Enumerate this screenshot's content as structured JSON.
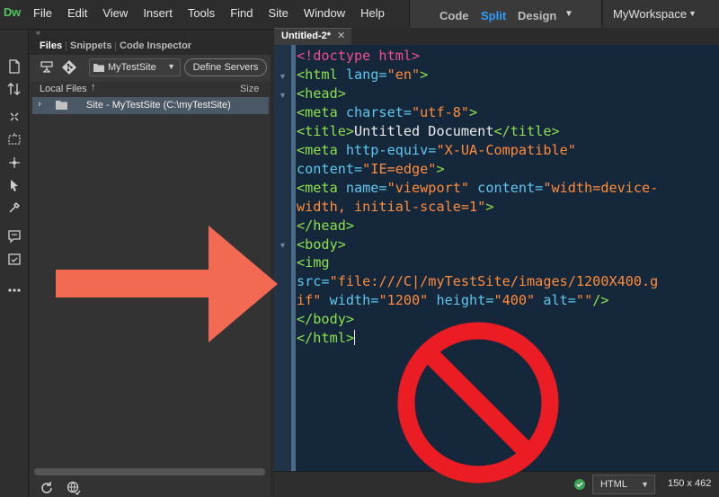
{
  "app": {
    "logo": "Dw",
    "menu": [
      "File",
      "Edit",
      "View",
      "Insert",
      "Tools",
      "Find",
      "Site",
      "Window",
      "Help"
    ],
    "view_switcher": {
      "code": "Code",
      "split": "Split",
      "design": "Design",
      "active": "Split"
    },
    "workspace": "MyWorkspace"
  },
  "files_panel": {
    "tabs": [
      "Files",
      "Snippets",
      "Code Inspector"
    ],
    "active_tab": "Files",
    "site_select": "MyTestSite",
    "define_servers": "Define Servers",
    "column_local": "Local Files",
    "column_size": "Size",
    "site_row_label": "Site - MyTestSite (C:\\myTestSite)"
  },
  "document": {
    "tab_label": "Untitled-2*",
    "code_lines": [
      [
        [
          "d",
          "<!doctype html>"
        ]
      ],
      [
        [
          "t",
          "<html"
        ],
        [
          "a",
          " lang="
        ],
        [
          "v",
          "\"en\""
        ],
        [
          "t",
          ">"
        ]
      ],
      [
        [
          "t",
          "<head>"
        ]
      ],
      [
        [
          "t",
          "<meta"
        ],
        [
          "a",
          " charset="
        ],
        [
          "v",
          "\"utf-8\""
        ],
        [
          "t",
          ">"
        ]
      ],
      [
        [
          "t",
          "<title>"
        ],
        [
          "x",
          "Untitled Document"
        ],
        [
          "t",
          "</title>"
        ]
      ],
      [
        [
          "t",
          "<meta"
        ],
        [
          "a",
          " http-equiv="
        ],
        [
          "v",
          "\"X-UA-Compatible\""
        ]
      ],
      [
        [
          "a",
          "content="
        ],
        [
          "v",
          "\"IE=edge\""
        ],
        [
          "t",
          ">"
        ]
      ],
      [
        [
          "t",
          "<meta"
        ],
        [
          "a",
          " name="
        ],
        [
          "v",
          "\"viewport\""
        ],
        [
          "a",
          " content="
        ],
        [
          "v",
          "\"width=device-"
        ]
      ],
      [
        [
          "v",
          "width, initial-scale=1\""
        ],
        [
          "t",
          ">"
        ]
      ],
      [
        [
          "t",
          "</head>"
        ]
      ],
      [
        [
          "t",
          "<body>"
        ]
      ],
      [
        [
          "t",
          "<img"
        ]
      ],
      [
        [
          "a",
          "src="
        ],
        [
          "v",
          "\"file:///C|/myTestSite/images/1200X400.g"
        ]
      ],
      [
        [
          "v",
          "if\""
        ],
        [
          "a",
          " width="
        ],
        [
          "v",
          "\"1200\""
        ],
        [
          "a",
          " height="
        ],
        [
          "v",
          "\"400\""
        ],
        [
          "a",
          " alt="
        ],
        [
          "v",
          "\"\""
        ],
        [
          "t",
          "/>"
        ]
      ],
      [
        [
          "t",
          "</body>"
        ]
      ],
      [
        [
          "t",
          "</html>"
        ]
      ]
    ]
  },
  "status_bar": {
    "language": "HTML",
    "dimensions": "150 x 462"
  },
  "colors": {
    "code_background": "#15273a",
    "tag": "#8de04f",
    "attribute": "#5ec7ee",
    "value": "#ff8c3a",
    "doctype": "#ec4e8e",
    "accent_split": "#2e9dff",
    "arrow": "#f36a52",
    "prohibition_sign": "#ec1c24"
  },
  "overlays": {
    "arrow_icon": "right-arrow",
    "prohibition_icon": "no-symbol"
  }
}
